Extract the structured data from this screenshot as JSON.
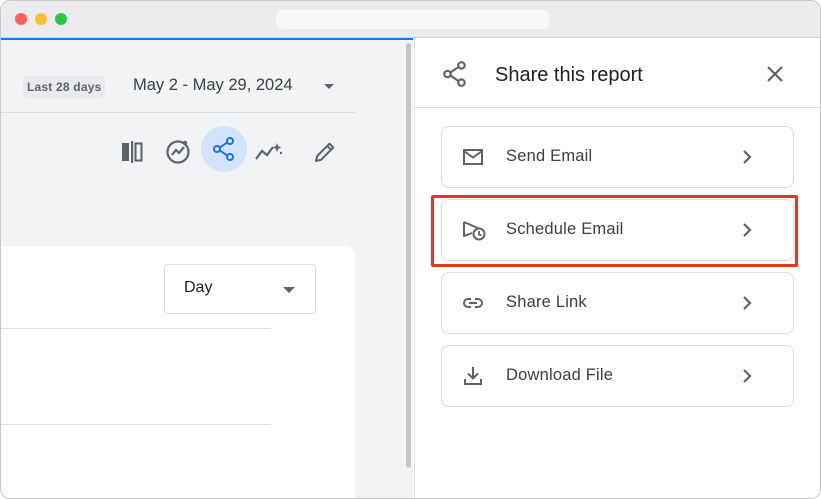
{
  "date_range": {
    "chip_label": "Last 28 days",
    "range_text": "May 2 - May 29, 2024"
  },
  "toolbar": {
    "icons": [
      "compare-icon",
      "insights-icon",
      "share-icon",
      "explore-icon",
      "edit-icon"
    ]
  },
  "chart_card": {
    "granularity_value": "Day"
  },
  "share_panel": {
    "title": "Share this report",
    "options": [
      {
        "label": "Send Email",
        "icon": "mail-icon"
      },
      {
        "label": "Schedule Email",
        "icon": "schedule-send-icon"
      },
      {
        "label": "Share Link",
        "icon": "link-icon"
      },
      {
        "label": "Download File",
        "icon": "download-icon"
      }
    ]
  },
  "colors": {
    "accent": "#1a73e8",
    "highlight_box": "#ea3323",
    "active_tool_bg": "#d2e3fc"
  }
}
